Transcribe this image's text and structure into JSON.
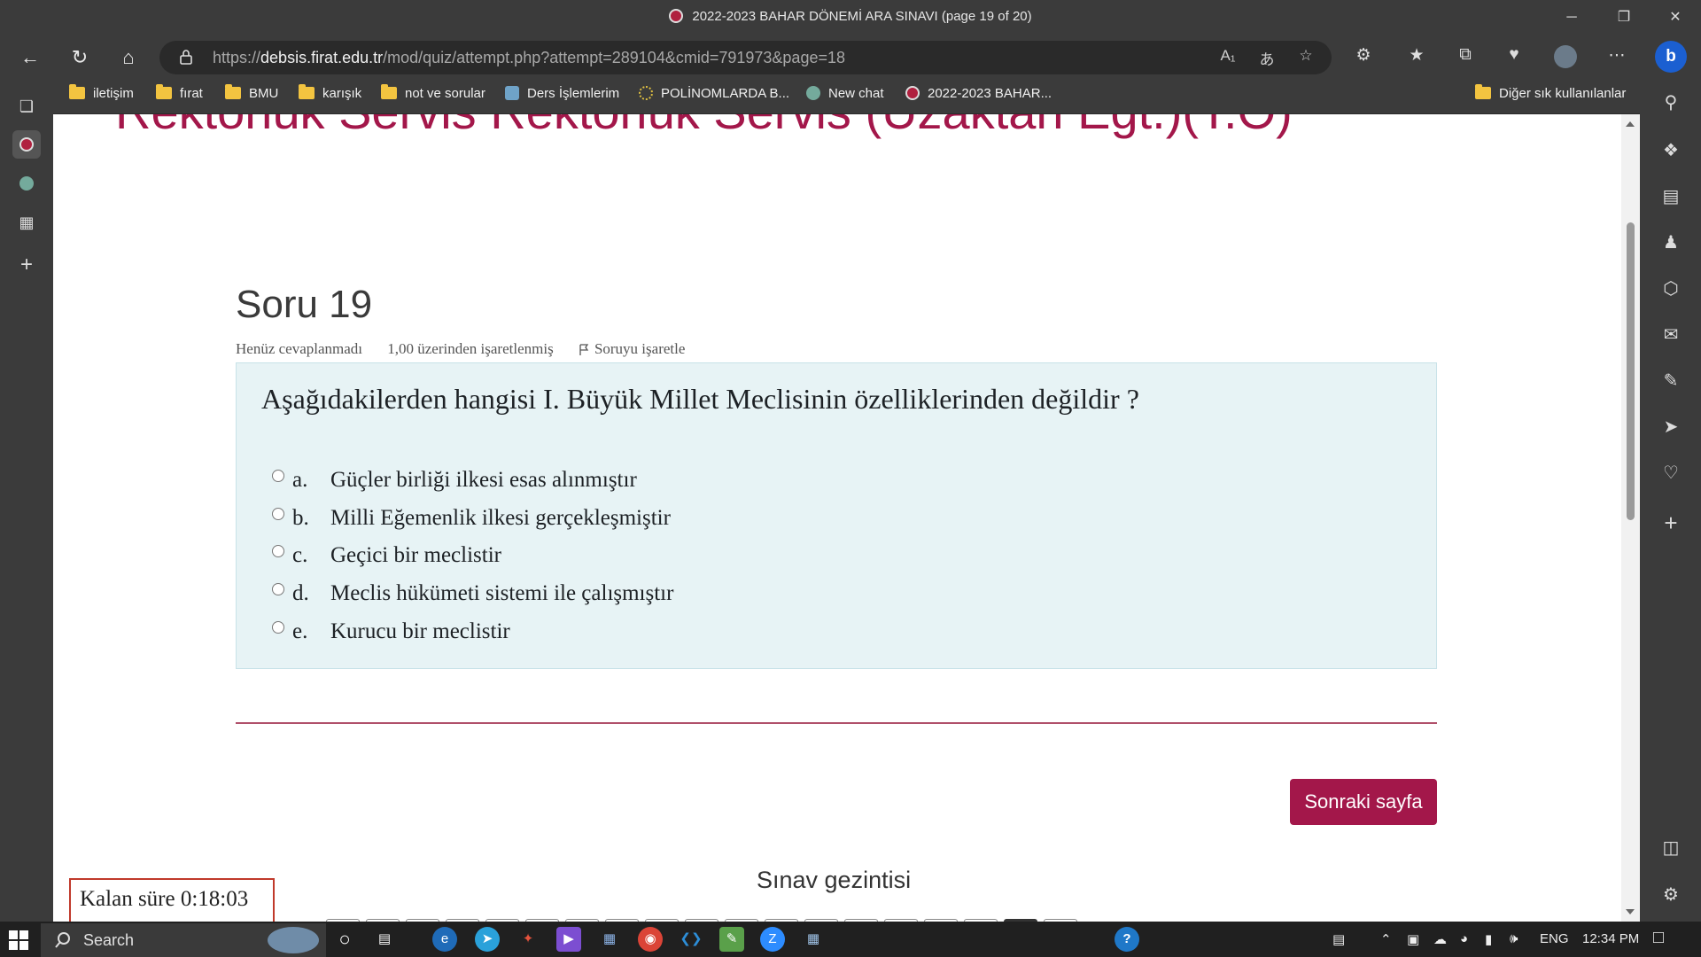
{
  "window": {
    "title": "2022-2023 BAHAR DÖNEMİ ARA SINAVI (page 19 of 20)",
    "minimize": "─",
    "maximize": "❐",
    "close": "✕"
  },
  "address": {
    "prefix": "https://",
    "domain": "debsis.firat.edu.tr",
    "path": "/mod/quiz/attempt.php?attempt=289104&cmid=791973&page=18"
  },
  "bookmarks": [
    {
      "label": "iletişim",
      "icon": "folder-icon"
    },
    {
      "label": "fırat",
      "icon": "folder-icon"
    },
    {
      "label": "BMU",
      "icon": "folder-icon"
    },
    {
      "label": "karışık",
      "icon": "folder-icon"
    },
    {
      "label": "not ve sorular",
      "icon": "folder-icon"
    },
    {
      "label": "Ders İşlemlerim",
      "icon": "dersler-icon"
    },
    {
      "label": "POLİNOMLARDA B...",
      "icon": "eu-stars-icon"
    },
    {
      "label": "New chat",
      "icon": "openai-icon"
    },
    {
      "label": "2022-2023 BAHAR...",
      "icon": "firat-icon"
    }
  ],
  "bookmarks_other": "Diğer sık kullanılanlar",
  "page": {
    "banner": "Rektörlük Servis Rektörlük Servis (Uzaktan Egt.)(T.Ö)",
    "question_title": "Soru 19",
    "status": "Henüz cevaplanmadı",
    "marks": "1,00 üzerinden işaretlenmiş",
    "flag_label": "Soruyu işaretle",
    "question_text": "Aşağıdakilerden hangisi I. Büyük Millet Meclisinin özelliklerinden değildir ?",
    "answers": [
      {
        "letter": "a.",
        "text": "Güçler birliği ilkesi esas alınmıştır"
      },
      {
        "letter": "b.",
        "text": "Milli Eğemenlik ilkesi gerçekleşmiştir"
      },
      {
        "letter": "c.",
        "text": "Geçici bir meclistir"
      },
      {
        "letter": "d.",
        "text": "Meclis hükümeti sistemi ile çalışmıştır"
      },
      {
        "letter": "e.",
        "text": "Kurucu bir meclistir"
      }
    ],
    "next_button": "Sonraki sayfa",
    "nav_title": "Sınav gezintisi",
    "timer": "Kalan süre 0:18:03"
  },
  "taskbar": {
    "search_label": "Search",
    "lang": "ENG",
    "time": "12:34 PM"
  },
  "colors": {
    "accent": "#a3174a",
    "question_bg": "#e7f3f5",
    "chrome": "#3b3b3b",
    "taskbar": "#202020"
  }
}
